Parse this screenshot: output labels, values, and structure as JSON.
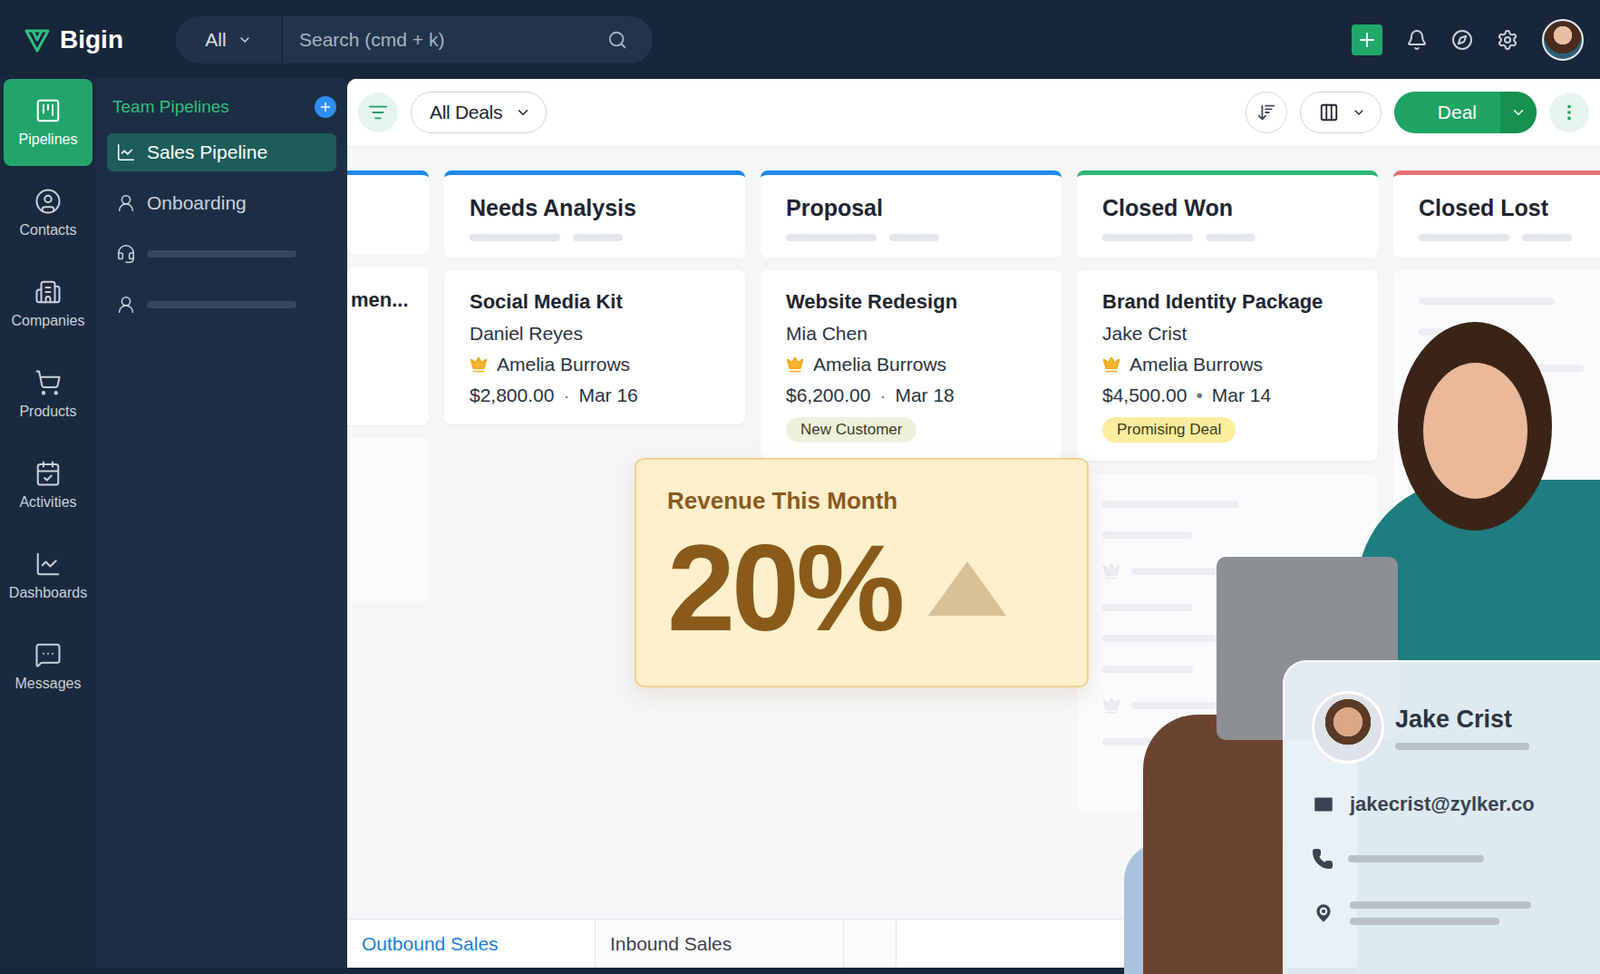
{
  "app": {
    "name": "Bigin"
  },
  "search": {
    "scope": "All",
    "placeholder": "Search (cmd + k)"
  },
  "rail": [
    {
      "label": "Pipelines",
      "selected": true
    },
    {
      "label": "Contacts",
      "selected": false
    },
    {
      "label": "Companies",
      "selected": false
    },
    {
      "label": "Products",
      "selected": false
    },
    {
      "label": "Activities",
      "selected": false
    },
    {
      "label": "Dashboards",
      "selected": false
    },
    {
      "label": "Messages",
      "selected": false
    }
  ],
  "sidebar": {
    "heading": "Team Pipelines",
    "items": [
      {
        "kind": "link",
        "label": "Sales Pipeline",
        "selected": true
      },
      {
        "kind": "link",
        "label": "Onboarding",
        "selected": false
      },
      {
        "kind": "placeholder",
        "selected": false
      },
      {
        "kind": "placeholder",
        "selected": false
      }
    ]
  },
  "toolbar": {
    "view": "All Deals",
    "create_button": "Deal"
  },
  "columns": [
    {
      "kind": "partial",
      "title": "",
      "color": "#1e88e5",
      "cards": [
        {
          "kind": "deal",
          "title": "men..."
        },
        {
          "kind": "placeholder",
          "lines": 0
        }
      ]
    },
    {
      "kind": "stage",
      "title": "Needs Analysis",
      "color": "#1e88e5",
      "cards": [
        {
          "kind": "deal",
          "title": "Social Media Kit",
          "contact": "Daniel Reyes",
          "owner": "Amelia Burrows",
          "amount": "$2,800.00",
          "separator": "·",
          "date": "Mar 16"
        }
      ]
    },
    {
      "kind": "stage",
      "title": "Proposal",
      "color": "#1e88e5",
      "cards": [
        {
          "kind": "deal",
          "title": "Website Redesign",
          "contact": "Mia Chen",
          "owner": "Amelia Burrows",
          "amount": "$6,200.00",
          "separator": "·",
          "date": "Mar 18",
          "tag": {
            "label": "New Customer",
            "color": "#eef2dc"
          }
        }
      ]
    },
    {
      "kind": "stage",
      "title": "Closed Won",
      "color": "#2bb673",
      "cards": [
        {
          "kind": "deal",
          "title": "Brand Identity Package",
          "contact": "Jake Crist",
          "owner": "Amelia Burrows",
          "amount": "$4,500.00",
          "separator": "•",
          "date": "Mar 14",
          "tag": {
            "label": "Promising Deal",
            "color": "#fbed9e"
          }
        },
        {
          "kind": "placeholder",
          "lines": 8
        }
      ]
    },
    {
      "kind": "stage",
      "title": "Closed Lost",
      "color": "#e57373",
      "cards": [
        {
          "kind": "placeholder",
          "lines": 3
        }
      ]
    }
  ],
  "bottom_tabs": [
    {
      "label": "Outbound Sales",
      "selected": true
    },
    {
      "label": "Inbound Sales",
      "selected": false
    }
  ],
  "revenue_card": {
    "title": "Revenue This Month",
    "value": "20%",
    "trend": "up"
  },
  "contact_card": {
    "name": "Jake Crist",
    "email": "jakecrist@zylker.co"
  }
}
